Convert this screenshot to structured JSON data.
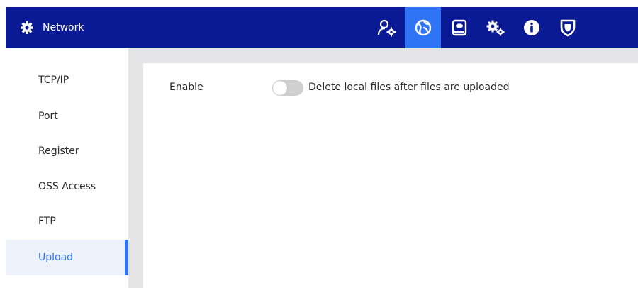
{
  "header": {
    "title": "Network",
    "title_icon": "gear-icon",
    "background": "#0a1a94",
    "active_color": "#2f73f7",
    "nav": [
      {
        "name": "user-settings-icon",
        "active": false
      },
      {
        "name": "network-globe-icon",
        "active": true
      },
      {
        "name": "storage-disk-icon",
        "active": false
      },
      {
        "name": "system-gears-icon",
        "active": false
      },
      {
        "name": "info-icon",
        "active": false
      },
      {
        "name": "security-shield-icon",
        "active": false
      }
    ]
  },
  "sidebar": {
    "items": [
      {
        "label": "TCP/IP",
        "active": false
      },
      {
        "label": "Port",
        "active": false
      },
      {
        "label": "Register",
        "active": false
      },
      {
        "label": "OSS Access",
        "active": false
      },
      {
        "label": "FTP",
        "active": false
      },
      {
        "label": "Upload",
        "active": true
      }
    ]
  },
  "upload": {
    "enable_label": "Enable",
    "toggle_on": false,
    "toggle_text": "Delete local files after files are uploaded"
  }
}
